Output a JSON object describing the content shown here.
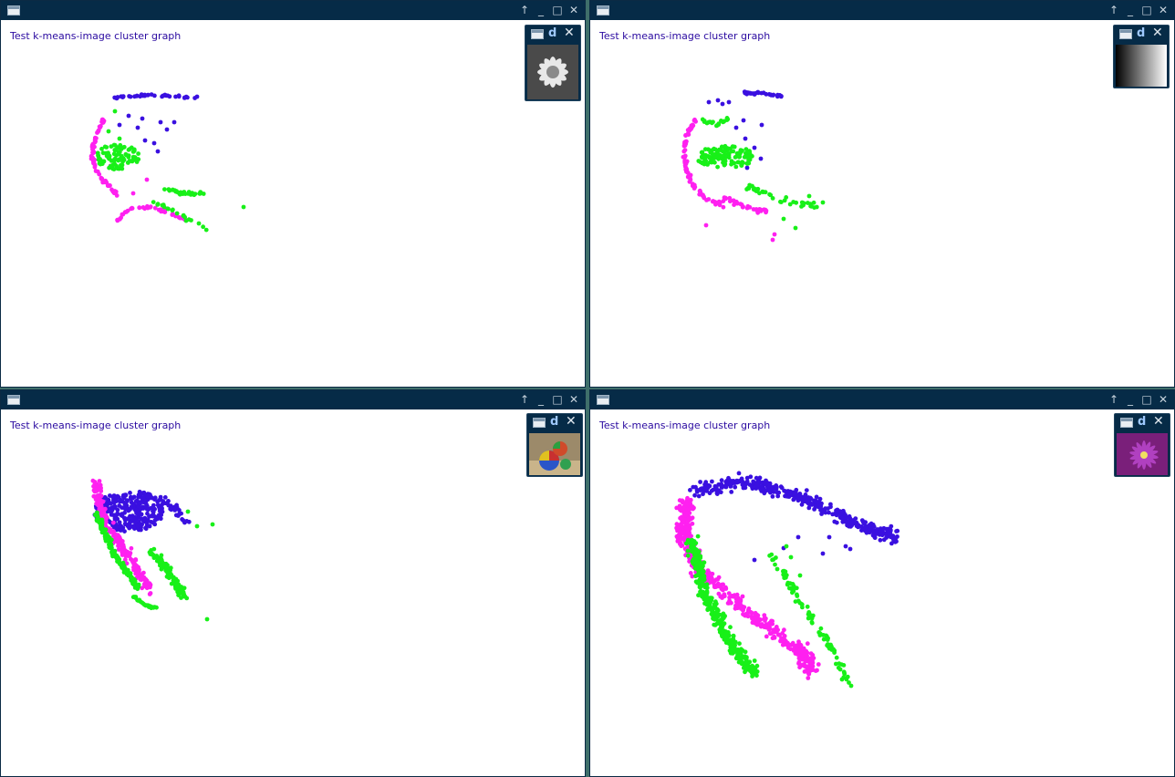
{
  "windows": [
    {
      "heading": "Test k-means-image cluster graph",
      "buttons": {
        "up": "↑",
        "minimize": "_",
        "maximize": "□",
        "close": "✕"
      },
      "thumbnail": {
        "id_glyph": "d",
        "close_glyph": "✕",
        "image": "grayscale-daisy"
      }
    },
    {
      "heading": "Test k-means-image cluster graph",
      "buttons": {
        "up": "↑",
        "minimize": "_",
        "maximize": "□",
        "close": "✕"
      },
      "thumbnail": {
        "id_glyph": "d",
        "close_glyph": "✕",
        "image": "gray-gradient"
      }
    },
    {
      "heading": "Test k-means-image cluster graph",
      "buttons": {
        "up": "↑",
        "minimize": "_",
        "maximize": "□",
        "close": "✕"
      },
      "thumbnail": {
        "id_glyph": "d",
        "close_glyph": "✕",
        "image": "colored-balls"
      }
    },
    {
      "heading": "Test k-means-image cluster graph",
      "buttons": {
        "up": "↑",
        "minimize": "_",
        "maximize": "□",
        "close": "✕"
      },
      "thumbnail": {
        "id_glyph": "d",
        "close_glyph": "✕",
        "image": "purple-flower"
      }
    }
  ],
  "colors": {
    "cluster_blue": "#3a10e0",
    "cluster_magenta": "#ff20f0",
    "cluster_green": "#18f018",
    "titlebar": "#062b47",
    "heading_text": "#2a0aa0"
  }
}
